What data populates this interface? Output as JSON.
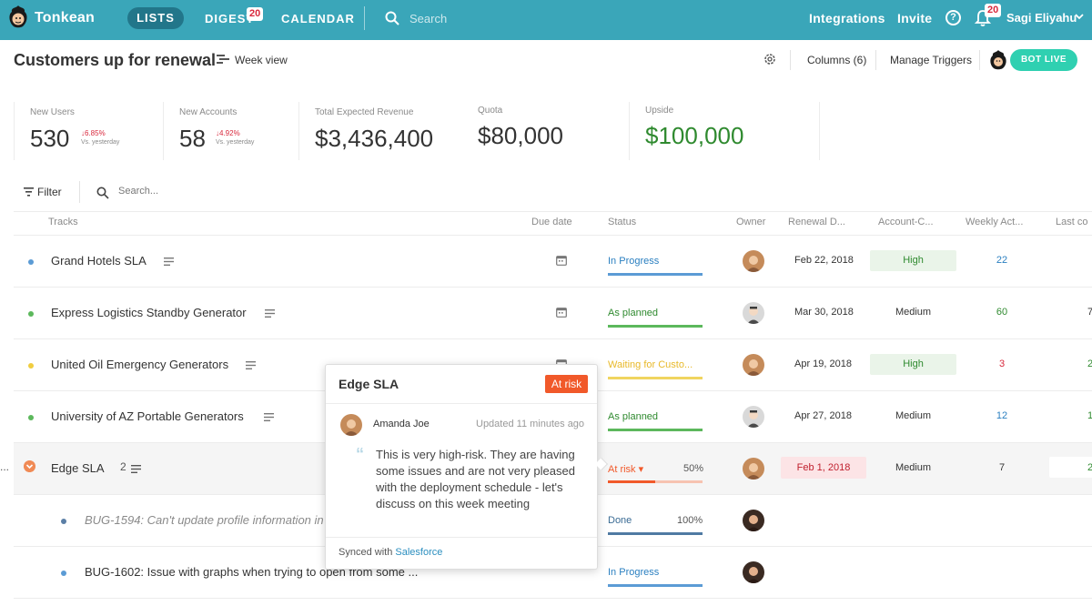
{
  "nav": {
    "brand": "Tonkean",
    "lists": "LISTS",
    "digest": "DIGEST",
    "digest_badge": "20",
    "calendar": "CALENDAR",
    "search_placeholder": "Search",
    "integrations": "Integrations",
    "invite": "Invite",
    "help": "?",
    "bell_badge": "20",
    "user": "Sagi Eliyahu"
  },
  "header": {
    "title": "Customers up for renewal",
    "week_view": "Week view",
    "columns": "Columns (6)",
    "manage_triggers": "Manage Triggers",
    "bot_live": "BOT LIVE"
  },
  "kpis": [
    {
      "label": "New Users",
      "value": "530",
      "change": "6.85%",
      "vs": "Vs. yesterday"
    },
    {
      "label": "New Accounts",
      "value": "58",
      "change": "4.92%",
      "vs": "Vs. yesterday"
    },
    {
      "label": "Total Expected Revenue",
      "value": "$3,436,400"
    },
    {
      "label": "Quota",
      "value": "$80,000"
    },
    {
      "label": "Upside",
      "value": "$100,000"
    }
  ],
  "filter": {
    "label": "Filter",
    "search_placeholder": "Search..."
  },
  "columns": {
    "tracks": "Tracks",
    "due_date": "Due date",
    "status": "Status",
    "owner": "Owner",
    "renewal": "Renewal D...",
    "account": "Account-C...",
    "weekly": "Weekly Act...",
    "last": "Last co"
  },
  "rows": [
    {
      "name": "Grand Hotels SLA",
      "status": "In Progress",
      "date": "Feb 22, 2018",
      "account": "High",
      "weekly": "22",
      "last": ""
    },
    {
      "name": "Express Logistics Standby Generator",
      "status": "As planned",
      "date": "Mar 30, 2018",
      "account": "Medium",
      "weekly": "60",
      "last": "7"
    },
    {
      "name": "United Oil Emergency Generators",
      "status": "Waiting for Custo...",
      "date": "Apr 19, 2018",
      "account": "High",
      "weekly": "3",
      "last": "2"
    },
    {
      "name": "University of AZ Portable Generators",
      "status": "As planned",
      "date": "Apr 27, 2018",
      "account": "Medium",
      "weekly": "12",
      "last": "1"
    },
    {
      "name": "Edge SLA",
      "count": "2",
      "status": "At risk",
      "pct": "50%",
      "date": "Feb 1, 2018",
      "account": "Medium",
      "weekly": "7",
      "last": "2"
    },
    {
      "name": "BUG-1594: Can't update profile information in l",
      "status": "Done",
      "pct": "100%"
    },
    {
      "name": "BUG-1602: Issue with graphs when trying to open from some ...",
      "status": "In Progress"
    }
  ],
  "ellipsis": "...",
  "popover": {
    "title": "Edge SLA",
    "badge": "At risk",
    "user": "Amanda Joe",
    "updated": "Updated 11 minutes ago",
    "quote_mark": "“",
    "text": "This is very high-risk. They are having some issues and are not very pleased with the deployment schedule - let's discuss on this week meeting",
    "synced_prefix": "Synced with",
    "synced_link": "Salesforce"
  },
  "colors": {
    "topbar": "#3aa6b9",
    "blue": "#2a7fc0",
    "green": "#2f8a2f",
    "yellow": "#e8c52a",
    "orange": "#f1592a",
    "bot": "#2fd0b1"
  }
}
